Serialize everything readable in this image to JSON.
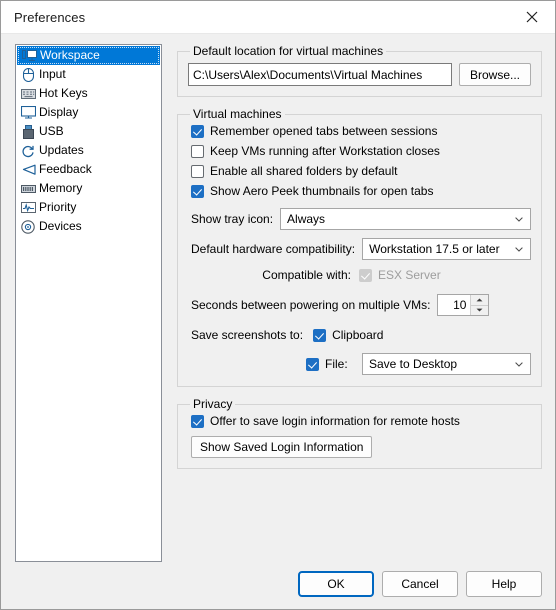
{
  "window": {
    "title": "Preferences",
    "close_icon": "close-icon"
  },
  "sidebar": {
    "items": [
      {
        "label": "Workspace",
        "icon": "monitor-icon",
        "selected": true
      },
      {
        "label": "Input",
        "icon": "mouse-icon",
        "selected": false
      },
      {
        "label": "Hot Keys",
        "icon": "keyboard-icon",
        "selected": false
      },
      {
        "label": "Display",
        "icon": "display-icon",
        "selected": false
      },
      {
        "label": "USB",
        "icon": "usb-icon",
        "selected": false
      },
      {
        "label": "Updates",
        "icon": "refresh-icon",
        "selected": false
      },
      {
        "label": "Feedback",
        "icon": "megaphone-icon",
        "selected": false
      },
      {
        "label": "Memory",
        "icon": "memory-icon",
        "selected": false
      },
      {
        "label": "Priority",
        "icon": "waveform-icon",
        "selected": false
      },
      {
        "label": "Devices",
        "icon": "disc-icon",
        "selected": false
      }
    ]
  },
  "default_location": {
    "legend": "Default location for virtual machines",
    "path_value": "C:\\Users\\Alex\\Documents\\Virtual Machines",
    "browse_label": "Browse..."
  },
  "virtual_machines": {
    "legend": "Virtual machines",
    "checkboxes": [
      {
        "label": "Remember opened tabs between sessions",
        "checked": true,
        "disabled": false
      },
      {
        "label": "Keep VMs running after Workstation closes",
        "checked": false,
        "disabled": false
      },
      {
        "label": "Enable all shared folders by default",
        "checked": false,
        "disabled": false
      },
      {
        "label": "Show Aero Peek thumbnails for open tabs",
        "checked": true,
        "disabled": false
      }
    ],
    "tray_icon": {
      "label": "Show tray icon:",
      "value": "Always"
    },
    "hardware_compat": {
      "label": "Default hardware compatibility:",
      "value": "Workstation 17.5 or later"
    },
    "compatible_with": {
      "label": "Compatible with:",
      "option_label": "ESX Server",
      "checked": true,
      "disabled": true
    },
    "power_delay": {
      "label": "Seconds between powering on multiple VMs:",
      "value": "10"
    },
    "screenshots": {
      "label": "Save screenshots to:",
      "clipboard_label": "Clipboard",
      "clipboard_checked": true,
      "file_label": "File:",
      "file_checked": true,
      "file_target": "Save to Desktop"
    }
  },
  "privacy": {
    "legend": "Privacy",
    "offer_save_login": {
      "label": "Offer to save login information for remote hosts",
      "checked": true
    },
    "show_saved_button": "Show Saved Login Information"
  },
  "footer": {
    "ok": "OK",
    "cancel": "Cancel",
    "help": "Help"
  },
  "colors": {
    "selection": "#0078d7",
    "checkbox_accent": "#1d6fc4",
    "default_button_border": "#0067c0",
    "dialog_bg": "#f0f0f0"
  }
}
